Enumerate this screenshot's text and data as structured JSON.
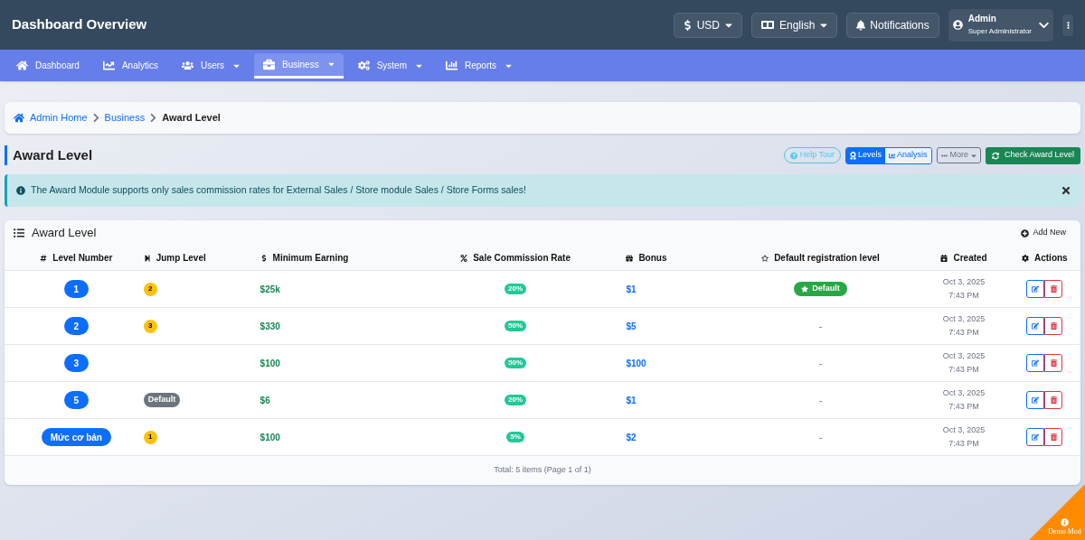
{
  "header": {
    "title": "Dashboard Overview",
    "currency": "USD",
    "language": "English",
    "notifications": "Notifications",
    "user": {
      "name": "Admin",
      "role": "Super Administrator"
    }
  },
  "nav": [
    {
      "label": "Dashboard",
      "selected": false,
      "dropdown": false
    },
    {
      "label": "Analytics",
      "selected": false,
      "dropdown": false
    },
    {
      "label": "Users",
      "selected": false,
      "dropdown": true
    },
    {
      "label": "Business",
      "selected": true,
      "dropdown": true
    },
    {
      "label": "System",
      "selected": false,
      "dropdown": true
    },
    {
      "label": "Reports",
      "selected": false,
      "dropdown": true
    }
  ],
  "breadcrumb": [
    {
      "label": "Admin Home",
      "current": false
    },
    {
      "label": "Business",
      "current": false
    },
    {
      "label": "Award Level",
      "current": true
    }
  ],
  "page_title": "Award Level",
  "toolbar": {
    "help": "Help Tour",
    "views": [
      {
        "label": "Levels",
        "selected": true
      },
      {
        "label": "Analysis",
        "selected": false
      }
    ],
    "more": "More",
    "check": "Check Award Level"
  },
  "alert": "The Award Module supports only sales commission rates for External Sales / Store module Sales / Store Forms sales!",
  "card": {
    "title": "Award Level",
    "add": "Add New"
  },
  "table": {
    "columns": [
      "Level Number",
      "Jump Level",
      "Minimum Earning",
      "Sale Commission Rate",
      "Bonus",
      "Default registration level",
      "Created",
      "Actions"
    ],
    "rows": [
      {
        "level": "1",
        "jump": {
          "kind": "count",
          "text": "2"
        },
        "min": "$25k",
        "rate": "20%",
        "bonus": "$1",
        "default": {
          "kind": "badge",
          "text": "Default"
        },
        "date": "Oct 3, 2025",
        "time": "7:43 PM"
      },
      {
        "level": "2",
        "jump": {
          "kind": "count",
          "text": "3"
        },
        "min": "$330",
        "rate": "50%",
        "bonus": "$5",
        "default": {
          "kind": "none",
          "text": "-"
        },
        "date": "Oct 3, 2025",
        "time": "7:43 PM"
      },
      {
        "level": "3",
        "min": "$100",
        "rate": "50%",
        "bonus": "$100",
        "default": {
          "kind": "none",
          "text": "-"
        },
        "date": "Oct 3, 2025",
        "time": "7:43 PM"
      },
      {
        "level": "5",
        "jump": {
          "kind": "tag",
          "text": "Default"
        },
        "min": "$6",
        "rate": "20%",
        "bonus": "$1",
        "default": {
          "kind": "none",
          "text": "-"
        },
        "date": "Oct 3, 2025",
        "time": "7:43 PM"
      },
      {
        "level": "Mức cơ bản",
        "jump": {
          "kind": "count",
          "text": "1"
        },
        "min": "$100",
        "rate": "5%",
        "bonus": "$2",
        "default": {
          "kind": "none",
          "text": "-"
        },
        "date": "Oct 3, 2025",
        "time": "7:43 PM"
      }
    ],
    "footer": "Total: 5 items (Page 1 of 1)"
  },
  "demo_ribbon": "Demo Mod"
}
